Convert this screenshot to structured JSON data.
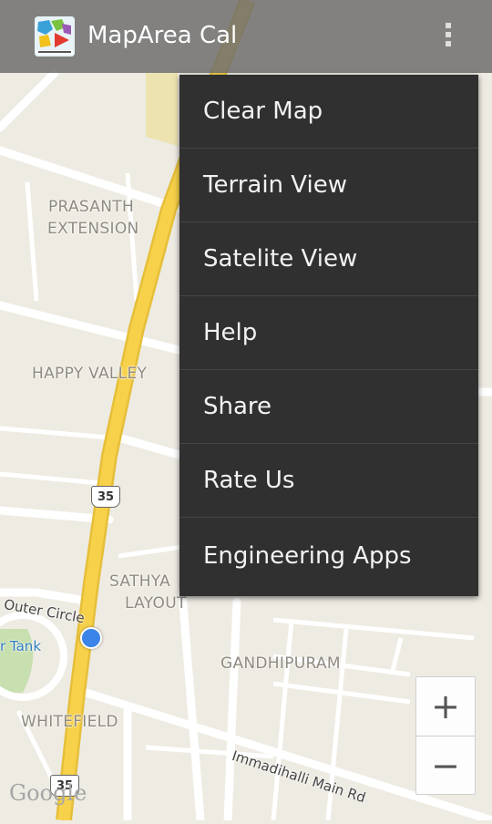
{
  "app_bar": {
    "title": "MapArea Cal",
    "icon_name": "app-logo-icon",
    "overflow_icon": "overflow-menu-icon"
  },
  "map": {
    "labels": {
      "prasanth_1": "PRASANTH",
      "prasanth_2": "EXTENSION",
      "happy_valley": "HAPPY VALLEY",
      "sathya_1": "SATHYA",
      "sathya_2": "LAYOUT",
      "gandhipuram": "GANDHIPURAM",
      "whitefield": "WHITEFIELD",
      "outer_circle": "Outer Circle",
      "tank": "r Tank",
      "main_rd": "Immadihalli Main Rd"
    },
    "shields": [
      "35",
      "35"
    ],
    "google_logo": "Google"
  },
  "menu": {
    "items": [
      "Clear Map",
      "Terrain View",
      "Satelite View",
      "Help",
      "Share",
      "Rate Us",
      "Engineering Apps"
    ]
  },
  "zoom": {
    "in": "+",
    "out": "−"
  },
  "colors": {
    "highway": "#f7d14a",
    "menu_bg": "#303030",
    "location": "#3b84e8"
  }
}
